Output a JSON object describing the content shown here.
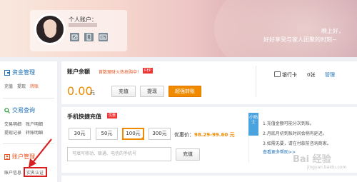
{
  "header": {
    "account_label": "个人账户：",
    "greeting_line1": "晚上好，",
    "greeting_line2": "好好享受与家人团聚的时刻~"
  },
  "sidebar": {
    "funds": {
      "title": "资金管理",
      "links": [
        "充值",
        "提现",
        "转账"
      ]
    },
    "transactions": {
      "title": "交易查询",
      "links": [
        "交易明细",
        "账户明细",
        "提现记录",
        "转账明细"
      ]
    },
    "account": {
      "title": "账户管理",
      "links": [
        "账户信息",
        "实名认证"
      ]
    }
  },
  "balance": {
    "title": "账户余额",
    "promo": "首数理财火热抢购中！",
    "badge": "REP",
    "amount": "0.00",
    "unit": "元",
    "buttons": {
      "recharge": "充值",
      "withdraw": "提现",
      "transfer": "超强转账"
    },
    "bank": {
      "label": "银行卡",
      "count": "0张",
      "manage": "管理"
    }
  },
  "phone_recharge": {
    "title": "手机快捷充值",
    "badge": "优惠",
    "amounts": [
      "30元",
      "50元",
      "100元",
      "300元"
    ],
    "selected": "100元",
    "price_label": "优惠价：",
    "price_value": "98.29-99.60 元",
    "input_placeholder": "可填写移动、联通、电信的手机号",
    "submit": "充值"
  },
  "tips": {
    "tag": "小贴士",
    "items": [
      "1.充值金额可能分次到账。",
      "2.月底月初到账时间会稍有延迟。",
      "3.如需无要，请在付款前咨询商家。"
    ],
    "more": "查看更多帮助>>"
  },
  "watermark": {
    "text": "Bai 经验",
    "url": "jingyan.baidu.com"
  },
  "colors": {
    "accent": "#f08a00",
    "link": "#1b6fb8",
    "highlight": "#d81e1e"
  }
}
